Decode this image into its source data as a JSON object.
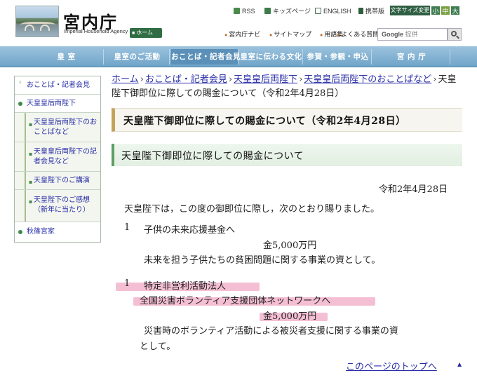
{
  "header": {
    "title": "宮内庁",
    "subtitle": "Imperial Household Agency",
    "home_label": "ホーム",
    "top_links": [
      "RSS",
      "キッズページ",
      "ENGLISH",
      "携帯版"
    ],
    "text_size_label": "文字サイズ変更",
    "text_size_options": [
      "小",
      "中",
      "大"
    ],
    "sub_links": [
      "宮内庁ナビ",
      "サイトマップ",
      "用語集",
      "よくある質問"
    ],
    "search_placeholder": "提供",
    "search_brand": "Google"
  },
  "main_nav": [
    "皇 室",
    "皇室のご活動",
    "おことば・記者会見",
    "皇室に伝わる文化",
    "参賀・参観・申込",
    "宮 内 庁"
  ],
  "active_nav_index": 2,
  "sidebar": {
    "items": [
      {
        "label": "おことば・記者会見"
      },
      {
        "label": "天皇皇后両陛下"
      },
      {
        "label": "天皇皇后両陛下のおことばなど"
      },
      {
        "label": "天皇皇后両陛下の記者会見など"
      },
      {
        "label": "天皇陛下のご講演"
      },
      {
        "label": "天皇陛下のご感想（新年に当たり）"
      },
      {
        "label": "秋篠宮家"
      }
    ]
  },
  "breadcrumb": {
    "links": [
      "ホーム",
      "おことば・記者会見",
      "天皇皇后両陛下",
      "天皇皇后両陛下のおことばなど"
    ],
    "current": "天皇陛下御即位に際しての賜金について（令和2年4月28日）"
  },
  "page_title": "天皇陛下御即位に際しての賜金について（令和2年4月28日）",
  "section_heading": "天皇陛下御即位に際しての賜金について",
  "date": "令和2年4月28日",
  "intro": "天皇陛下は，この度の御即位に際し，次のとおり賜りました。",
  "items": [
    {
      "number": "1",
      "recipient": "子供の未来応援基金へ",
      "amount": "金5,000万円",
      "purpose_lines": [
        "未来を担う子供たちの貧困問題に関する事業の資として。"
      ]
    },
    {
      "number": "1",
      "recipient": "特定非営利活動法人",
      "recipient_line2": "全国災害ボランティア支援団体ネットワークへ",
      "amount": "金5,000万円",
      "purpose_lines": [
        "災害時のボランティア活動による被災者支援に関する事業の資",
        "として。"
      ]
    }
  ],
  "page_top_link": "このページのトップへ",
  "colors": {
    "nav_blue": "#6fa4c8",
    "link": "#2a2fa8",
    "highlight_pink": "#f2a9c4",
    "accent_green": "#3f8a4b"
  }
}
